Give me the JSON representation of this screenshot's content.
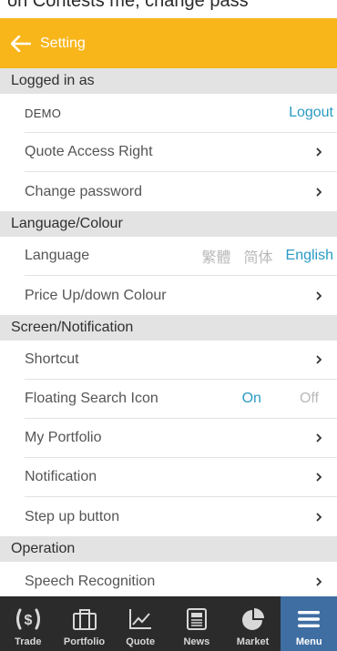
{
  "header": {
    "cut_text": "on Contests me, change pass",
    "title": "Setting"
  },
  "sections": {
    "logged_in": {
      "title": "Logged in as",
      "user": "DEMO",
      "logout": "Logout",
      "quote_access": "Quote Access Right",
      "change_password": "Change password"
    },
    "language_colour": {
      "title": "Language/Colour",
      "language_label": "Language",
      "options": [
        "繁體",
        "简体",
        "English"
      ],
      "selected": "English",
      "price_colour": "Price Up/down Colour"
    },
    "screen_notification": {
      "title": "Screen/Notification",
      "shortcut": "Shortcut",
      "floating_search": "Floating Search Icon",
      "on": "On",
      "off": "Off",
      "my_portfolio": "My Portfolio",
      "notification": "Notification",
      "step_up": "Step up button"
    },
    "operation": {
      "title": "Operation",
      "speech": "Speech Recognition"
    }
  },
  "bottom_nav": {
    "items": [
      {
        "label": "Trade",
        "icon": "dollar-icon"
      },
      {
        "label": "Portfolio",
        "icon": "briefcase-icon"
      },
      {
        "label": "Quote",
        "icon": "chart-line-icon"
      },
      {
        "label": "News",
        "icon": "newspaper-icon"
      },
      {
        "label": "Market",
        "icon": "pie-chart-icon"
      },
      {
        "label": "Menu",
        "icon": "hamburger-menu-icon"
      }
    ],
    "active": "Menu"
  },
  "colors": {
    "header": "#f8b61b",
    "accent": "#2a9bc4",
    "section_bg": "#e3e3e3",
    "nav_bg": "#2b2b2b",
    "nav_active": "#3f6ea2"
  }
}
